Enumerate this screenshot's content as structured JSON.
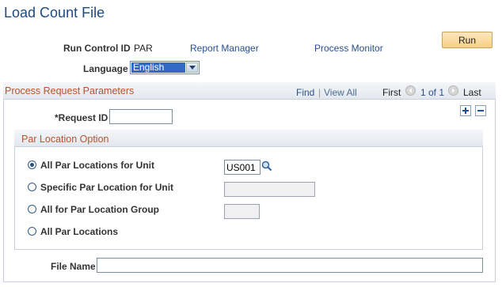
{
  "page": {
    "title": "Load Count File"
  },
  "header": {
    "run_control_label": "Run Control ID",
    "run_control_value": "PAR",
    "report_manager": "Report Manager",
    "process_monitor": "Process Monitor",
    "run_button": "Run",
    "language_label": "Language",
    "language_value": "English"
  },
  "panel": {
    "title": "Process Request Parameters",
    "find": "Find",
    "separator": "|",
    "view_all": "View All",
    "first": "First",
    "count": "1 of 1",
    "last": "Last",
    "request_id_label": "*Request ID",
    "request_id_value": ""
  },
  "par": {
    "title": "Par Location Option",
    "options": [
      {
        "label": "All Par Locations for Unit",
        "checked": true
      },
      {
        "label": "Specific Par Location for Unit",
        "checked": false
      },
      {
        "label": "All for Par Location Group",
        "checked": false
      },
      {
        "label": "All Par Locations",
        "checked": false
      }
    ],
    "unit_value": "US001"
  },
  "file": {
    "label": "File Name",
    "value": ""
  },
  "colors": {
    "title": "#1f4a80",
    "section_title": "#b5532d",
    "link": "#28508c",
    "run_button": "#f6cf86"
  },
  "icons": [
    "magnifier-icon",
    "plus-icon",
    "minus-icon",
    "prev-arrow-icon",
    "next-arrow-icon",
    "dropdown-arrow-icon"
  ]
}
